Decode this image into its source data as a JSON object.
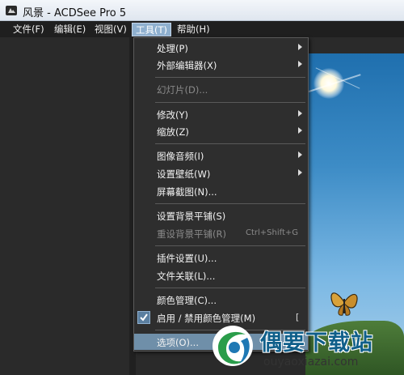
{
  "window": {
    "title": "风景 - ACDSee Pro 5"
  },
  "menubar": {
    "items": [
      {
        "label": "文件(F)"
      },
      {
        "label": "编辑(E)"
      },
      {
        "label": "视图(V)"
      },
      {
        "label": "工具(T)",
        "active": true
      },
      {
        "label": "帮助(H)"
      }
    ]
  },
  "tools_menu": {
    "items": [
      {
        "label": "处理(P)",
        "submenu": true
      },
      {
        "label": "外部编辑器(X)",
        "submenu": true
      },
      {
        "label": "幻灯片(D)...",
        "disabled": true
      },
      {
        "label": "修改(Y)",
        "submenu": true
      },
      {
        "label": "缩放(Z)",
        "submenu": true
      },
      {
        "label": "图像音频(I)",
        "submenu": true
      },
      {
        "label": "设置壁纸(W)",
        "submenu": true
      },
      {
        "label": "屏幕截图(N)..."
      },
      {
        "label": "设置背景平铺(S)"
      },
      {
        "label": "重设背景平铺(R)",
        "disabled": true,
        "shortcut": "Ctrl+Shift+G"
      },
      {
        "label": "插件设置(U)..."
      },
      {
        "label": "文件关联(L)..."
      },
      {
        "label": "颜色管理(C)..."
      },
      {
        "label": "启用 / 禁用颜色管理(M)",
        "checked": true,
        "trailing": "["
      },
      {
        "label": "选项(O)...",
        "selected": true
      }
    ]
  },
  "watermark": {
    "title": "偶要下载站",
    "url": "ouyaoxiazai.com"
  },
  "colors": {
    "menu_bg": "#2e2e2e",
    "menu_highlight": "#6f8fa9",
    "menubar_active": "#8fb0cf",
    "watermark_text": "#0f5f8a"
  }
}
